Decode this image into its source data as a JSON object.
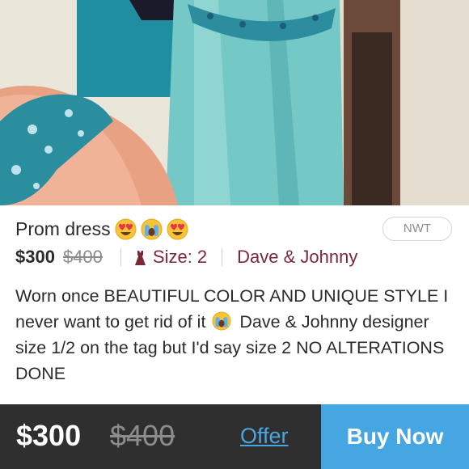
{
  "listing": {
    "title": "Prom dress",
    "title_emojis": [
      "heart-eyes-emoji",
      "crying-emoji",
      "heart-eyes-emoji"
    ],
    "condition_badge": "NWT",
    "price": "$300",
    "original_price": "$400",
    "size_label": "Size: 2",
    "brand": "Dave & Johnny",
    "description_part1": "Worn once BEAUTIFUL COLOR AND UNIQUE STYLE I never want to get rid of it",
    "description_part2": "Dave & Johnny designer size 1/2 on the tag but I'd say size 2 NO ALTERATIONS DONE",
    "description_emoji": "crying-emoji"
  },
  "purchase_bar": {
    "price": "$300",
    "original_price": "$400",
    "offer_label": "Offer",
    "buy_label": "Buy Now"
  },
  "colors": {
    "accent_blue": "#45a6e2",
    "brand_maroon": "#7a2938",
    "bar_dark": "#2f2f2f"
  },
  "icons": {
    "size": "dress-icon"
  }
}
